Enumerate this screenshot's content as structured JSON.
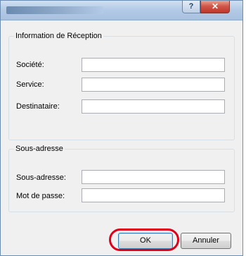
{
  "window": {
    "help_glyph": "?",
    "close_glyph": "✕"
  },
  "reception": {
    "title": "Information de Réception",
    "fields": [
      {
        "label": "Société:",
        "value": ""
      },
      {
        "label": "Service:",
        "value": ""
      },
      {
        "label": "Destinataire:",
        "value": ""
      }
    ]
  },
  "subaddress": {
    "title": "Sous-adresse",
    "fields": [
      {
        "label": "Sous-adresse:",
        "value": ""
      },
      {
        "label": "Mot de passe:",
        "value": ""
      }
    ]
  },
  "buttons": {
    "ok": "OK",
    "cancel": "Annuler"
  },
  "colors": {
    "highlight": "#e0001a",
    "window_bg": "#f0f0f0",
    "titlebar": "#b4cbe6"
  }
}
